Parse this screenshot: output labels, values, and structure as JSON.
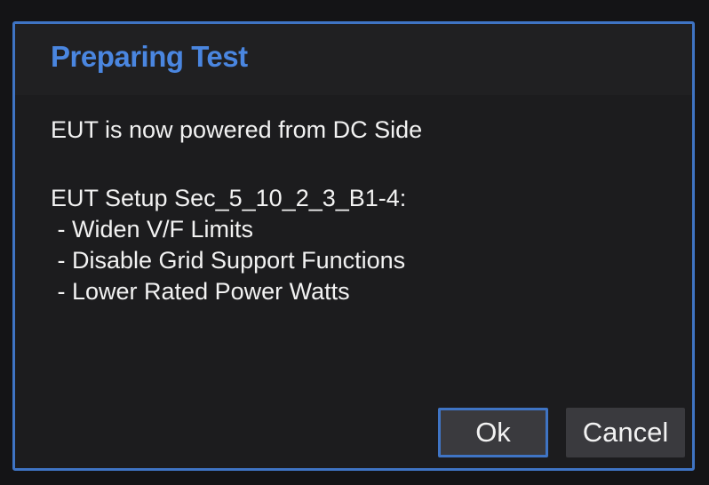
{
  "dialog": {
    "title": "Preparing Test",
    "message": "EUT is now powered from DC Side",
    "setup_heading": "EUT Setup Sec_5_10_2_3_B1-4:",
    "steps": [
      " - Widen V/F Limits",
      " - Disable Grid Support Functions",
      " - Lower Rated Power Watts"
    ],
    "ok_label": "Ok",
    "cancel_label": "Cancel"
  },
  "colors": {
    "accent": "#3f74c4",
    "title": "#4a86e0",
    "background": "#1c1c1e",
    "button": "#3a3a3e",
    "text": "#f2f2f2"
  }
}
